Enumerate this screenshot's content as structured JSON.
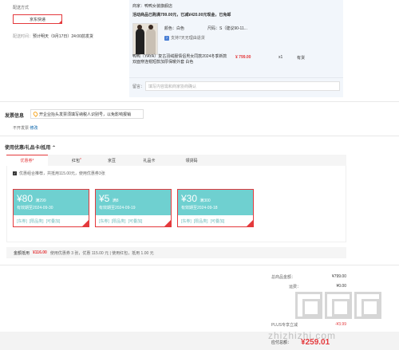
{
  "shipping": {
    "label": "配送方式",
    "method": "京东快递",
    "time_label": "配送时间：",
    "time_value": "预计明天（9月17日）24:00前发货"
  },
  "order": {
    "shop": "商家：鸭鸭女装旗舰店",
    "promo": "活动商品已购满799.00元，已减¥420.00元现金，已免邮",
    "color": "颜色：白色",
    "size": "尺码：S（建议90-11...",
    "return_note": "支持7天无理由退货",
    "return_icon": "7",
    "item_name": "鸭鸭（YAYA）复古羽绒服情侣男女同款2024冬季新款双面穿连帽短款加厚保暖外套 白色",
    "price": "¥ 799.00",
    "qty": "x1",
    "stock": "有货",
    "note_label": "留言：",
    "note_placeholder": "填写内容需和商家协商确认"
  },
  "invoice": {
    "title": "发票信息",
    "tip": "开企业抬头发票须填写纳税人识别号，以免影响报销",
    "status": "不开发票",
    "edit": "修改"
  },
  "coupons": {
    "title": "使用优惠/礼品卡/抵用",
    "tabs": [
      {
        "label": "优惠券",
        "star": "*"
      },
      {
        "label": "红包",
        "star": "*"
      },
      {
        "label": "京豆",
        "star": ""
      },
      {
        "label": "礼品卡",
        "star": ""
      },
      {
        "label": "领货码",
        "star": ""
      }
    ],
    "combo_note": "优惠组合推荐，共抵用115.00元，使用优惠券3张",
    "cards": [
      {
        "amount": "¥80",
        "cond": "满299",
        "valid": "有效期至2024-09-30",
        "tags": [
          "[东券]",
          "[限品类]",
          "[可叠加]"
        ]
      },
      {
        "amount": "¥5",
        "cond": "满8",
        "valid": "有效期至2024-09-19",
        "tags": [
          "[东券]",
          "[限品类]",
          "[可叠加]"
        ]
      },
      {
        "amount": "¥30",
        "cond": "满300",
        "valid": "有效期至2024-09-18",
        "tags": [
          "[东券]",
          "[限品类]",
          "[可叠加]"
        ]
      }
    ],
    "sum_label": "金额抵用",
    "sum_value": "¥116.00",
    "sum_detail": "使用优惠券 3 张，优惠 115.00 元 | 使用红包，抵用 1.00 元"
  },
  "totals": {
    "rows": [
      {
        "label": "总商品金额：",
        "value": "¥799.00"
      },
      {
        "label": "运费：",
        "value": "¥0.00"
      }
    ],
    "plus_label": "PLUS专享立减",
    "plus_value": "-¥3.99",
    "payable_label": "应付总额：",
    "payable_value": "¥259.01"
  },
  "watermark": {
    "text": "zhizhizhi.com"
  }
}
